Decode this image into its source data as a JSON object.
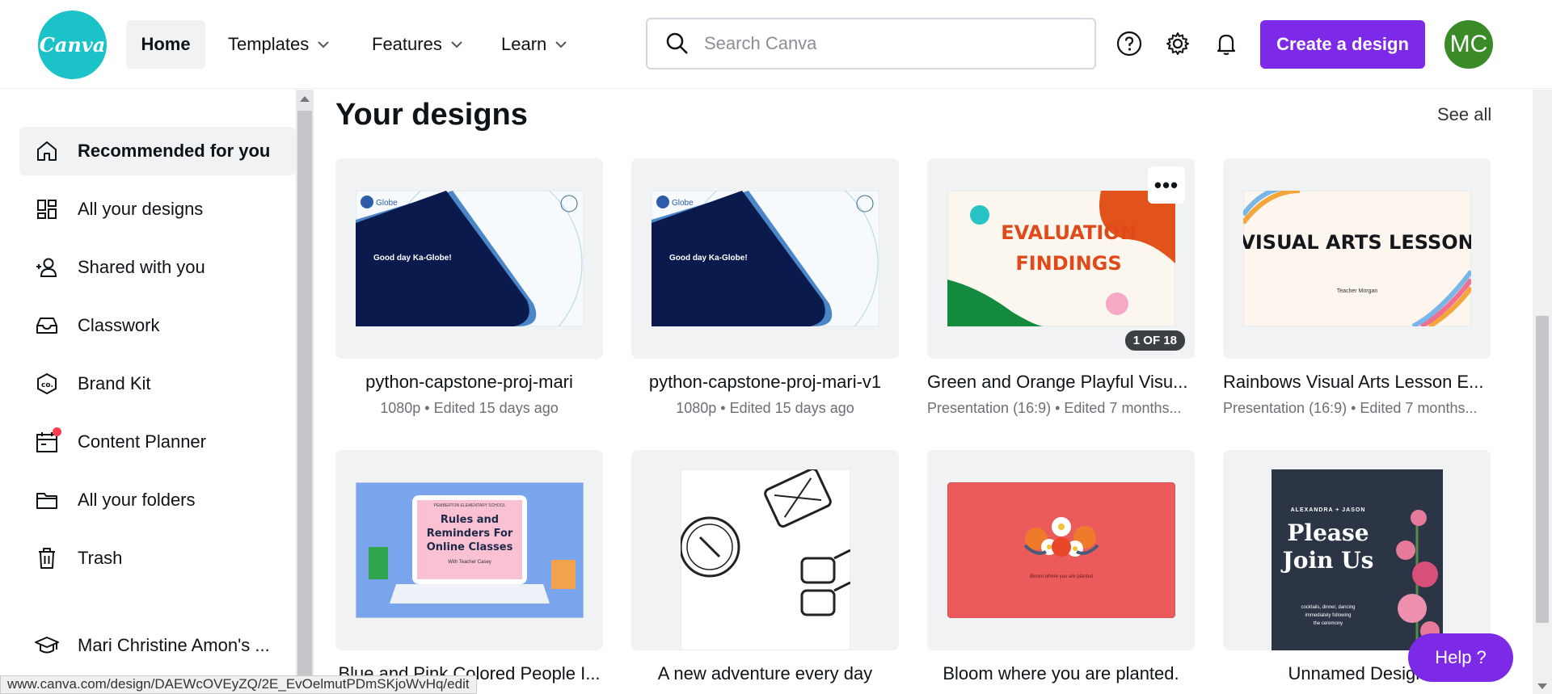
{
  "header": {
    "logo_text": "Canva",
    "nav": [
      {
        "label": "Home"
      },
      {
        "label": "Templates"
      },
      {
        "label": "Features"
      },
      {
        "label": "Learn"
      }
    ],
    "search_placeholder": "Search Canva",
    "create_label": "Create a design",
    "avatar_initials": "MC"
  },
  "sidebar": {
    "items": [
      {
        "label": "Recommended for you",
        "icon": "home-icon"
      },
      {
        "label": "All your designs",
        "icon": "grid-icon"
      },
      {
        "label": "Shared with you",
        "icon": "users-icon"
      },
      {
        "label": "Classwork",
        "icon": "inbox-icon"
      },
      {
        "label": "Brand Kit",
        "icon": "brand-icon"
      },
      {
        "label": "Content Planner",
        "icon": "calendar-icon"
      },
      {
        "label": "All your folders",
        "icon": "folder-icon"
      },
      {
        "label": "Trash",
        "icon": "trash-icon"
      },
      {
        "label": "Mari Christine Amon's ...",
        "icon": "graduation-cap-icon"
      }
    ]
  },
  "main": {
    "section_title": "Your designs",
    "see_all": "See all",
    "designs": [
      {
        "title": "python-capstone-proj-mari",
        "meta": "1080p • Edited 15 days ago",
        "thumb_text": "Good day Ka-Globe!",
        "brand": "Globe"
      },
      {
        "title": "python-capstone-proj-mari-v1",
        "meta": "1080p • Edited 15 days ago",
        "thumb_text": "Good day Ka-Globe!",
        "brand": "Globe"
      },
      {
        "title": "Green and Orange Playful Visu...",
        "meta": "Presentation (16:9) • Edited 7 months...",
        "thumb_text": "EVALUATION FINDINGS",
        "badge": "1 OF 18",
        "more": "•••"
      },
      {
        "title": "Rainbows Visual Arts Lesson E...",
        "meta": "Presentation (16:9) • Edited 7 months...",
        "thumb_text": "VISUAL ARTS LESSON",
        "thumb_sub": "Teacher Morgan"
      },
      {
        "title": "Blue and Pink Colored People I...",
        "thumb_text": "Rules and Reminders For Online Classes",
        "thumb_sub": "With Teacher Casey",
        "thumb_top": "PEMBERTON ELEMENTARY SCHOOL"
      },
      {
        "title": "A new adventure every day"
      },
      {
        "title": "Bloom where you are planted.",
        "thumb_text": "Bloom where you are planted"
      },
      {
        "title": "Unnamed Design",
        "thumb_text": "Please Join Us",
        "thumb_top": "ALEXANDRA + JASON",
        "thumb_sub": "cocktails, dinner, dancing immediately following the ceremony"
      }
    ]
  },
  "help_label": "Help ?",
  "status_url": "www.canva.com/design/DAEWcOVEyZQ/2E_EvOelmutPDmSKjoWvHq/edit",
  "colors": {
    "brand_purple": "#7d2ae8",
    "logo_teal": "#1bc3c8",
    "avatar_green": "#3a8a28"
  }
}
